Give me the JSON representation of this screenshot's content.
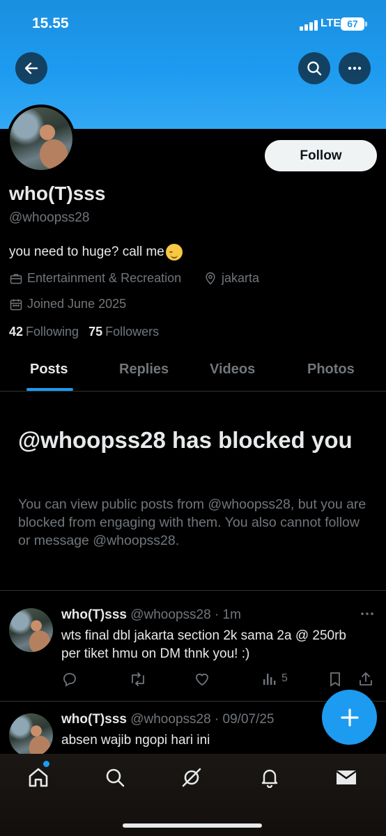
{
  "status_bar": {
    "time": "15.55",
    "network": "LTE",
    "battery": "67"
  },
  "header": {
    "back_icon": "arrow-left-icon",
    "search_icon": "search-icon",
    "more_icon": "ellipsis-icon"
  },
  "profile": {
    "display_name": "who(T)sss",
    "handle": "@whoopss28",
    "bio": "you need to huge? call me",
    "category": "Entertainment & Recreation",
    "location": "jakarta",
    "joined": "Joined June 2025",
    "following_count": "42",
    "following_label": "Following",
    "followers_count": "75",
    "followers_label": "Followers",
    "follow_button": "Follow"
  },
  "tabs": [
    {
      "label": "Posts",
      "active": true
    },
    {
      "label": "Replies",
      "active": false
    },
    {
      "label": "Videos",
      "active": false
    },
    {
      "label": "Photos",
      "active": false
    }
  ],
  "blocked_notice": {
    "title": "@whoopss28 has blocked you",
    "description": "You can view public posts from @whoopss28, but you are blocked from engaging with them. You also cannot follow or message @whoopss28."
  },
  "tweets": [
    {
      "name": "who(T)sss",
      "meta": "@whoopss28 · 1m",
      "text": "wts final dbl jakarta section 2k sama 2a @ 250rb per tiket hmu on DM thnk you! :)",
      "views": "5"
    },
    {
      "name": "who(T)sss",
      "meta": "@whoopss28 · 09/07/25",
      "text": "absen wajib ngopi hari ini"
    }
  ],
  "colors": {
    "accent": "#1d9bf0",
    "text": "#e7e9ea",
    "muted": "#71767b",
    "background": "#000000"
  }
}
